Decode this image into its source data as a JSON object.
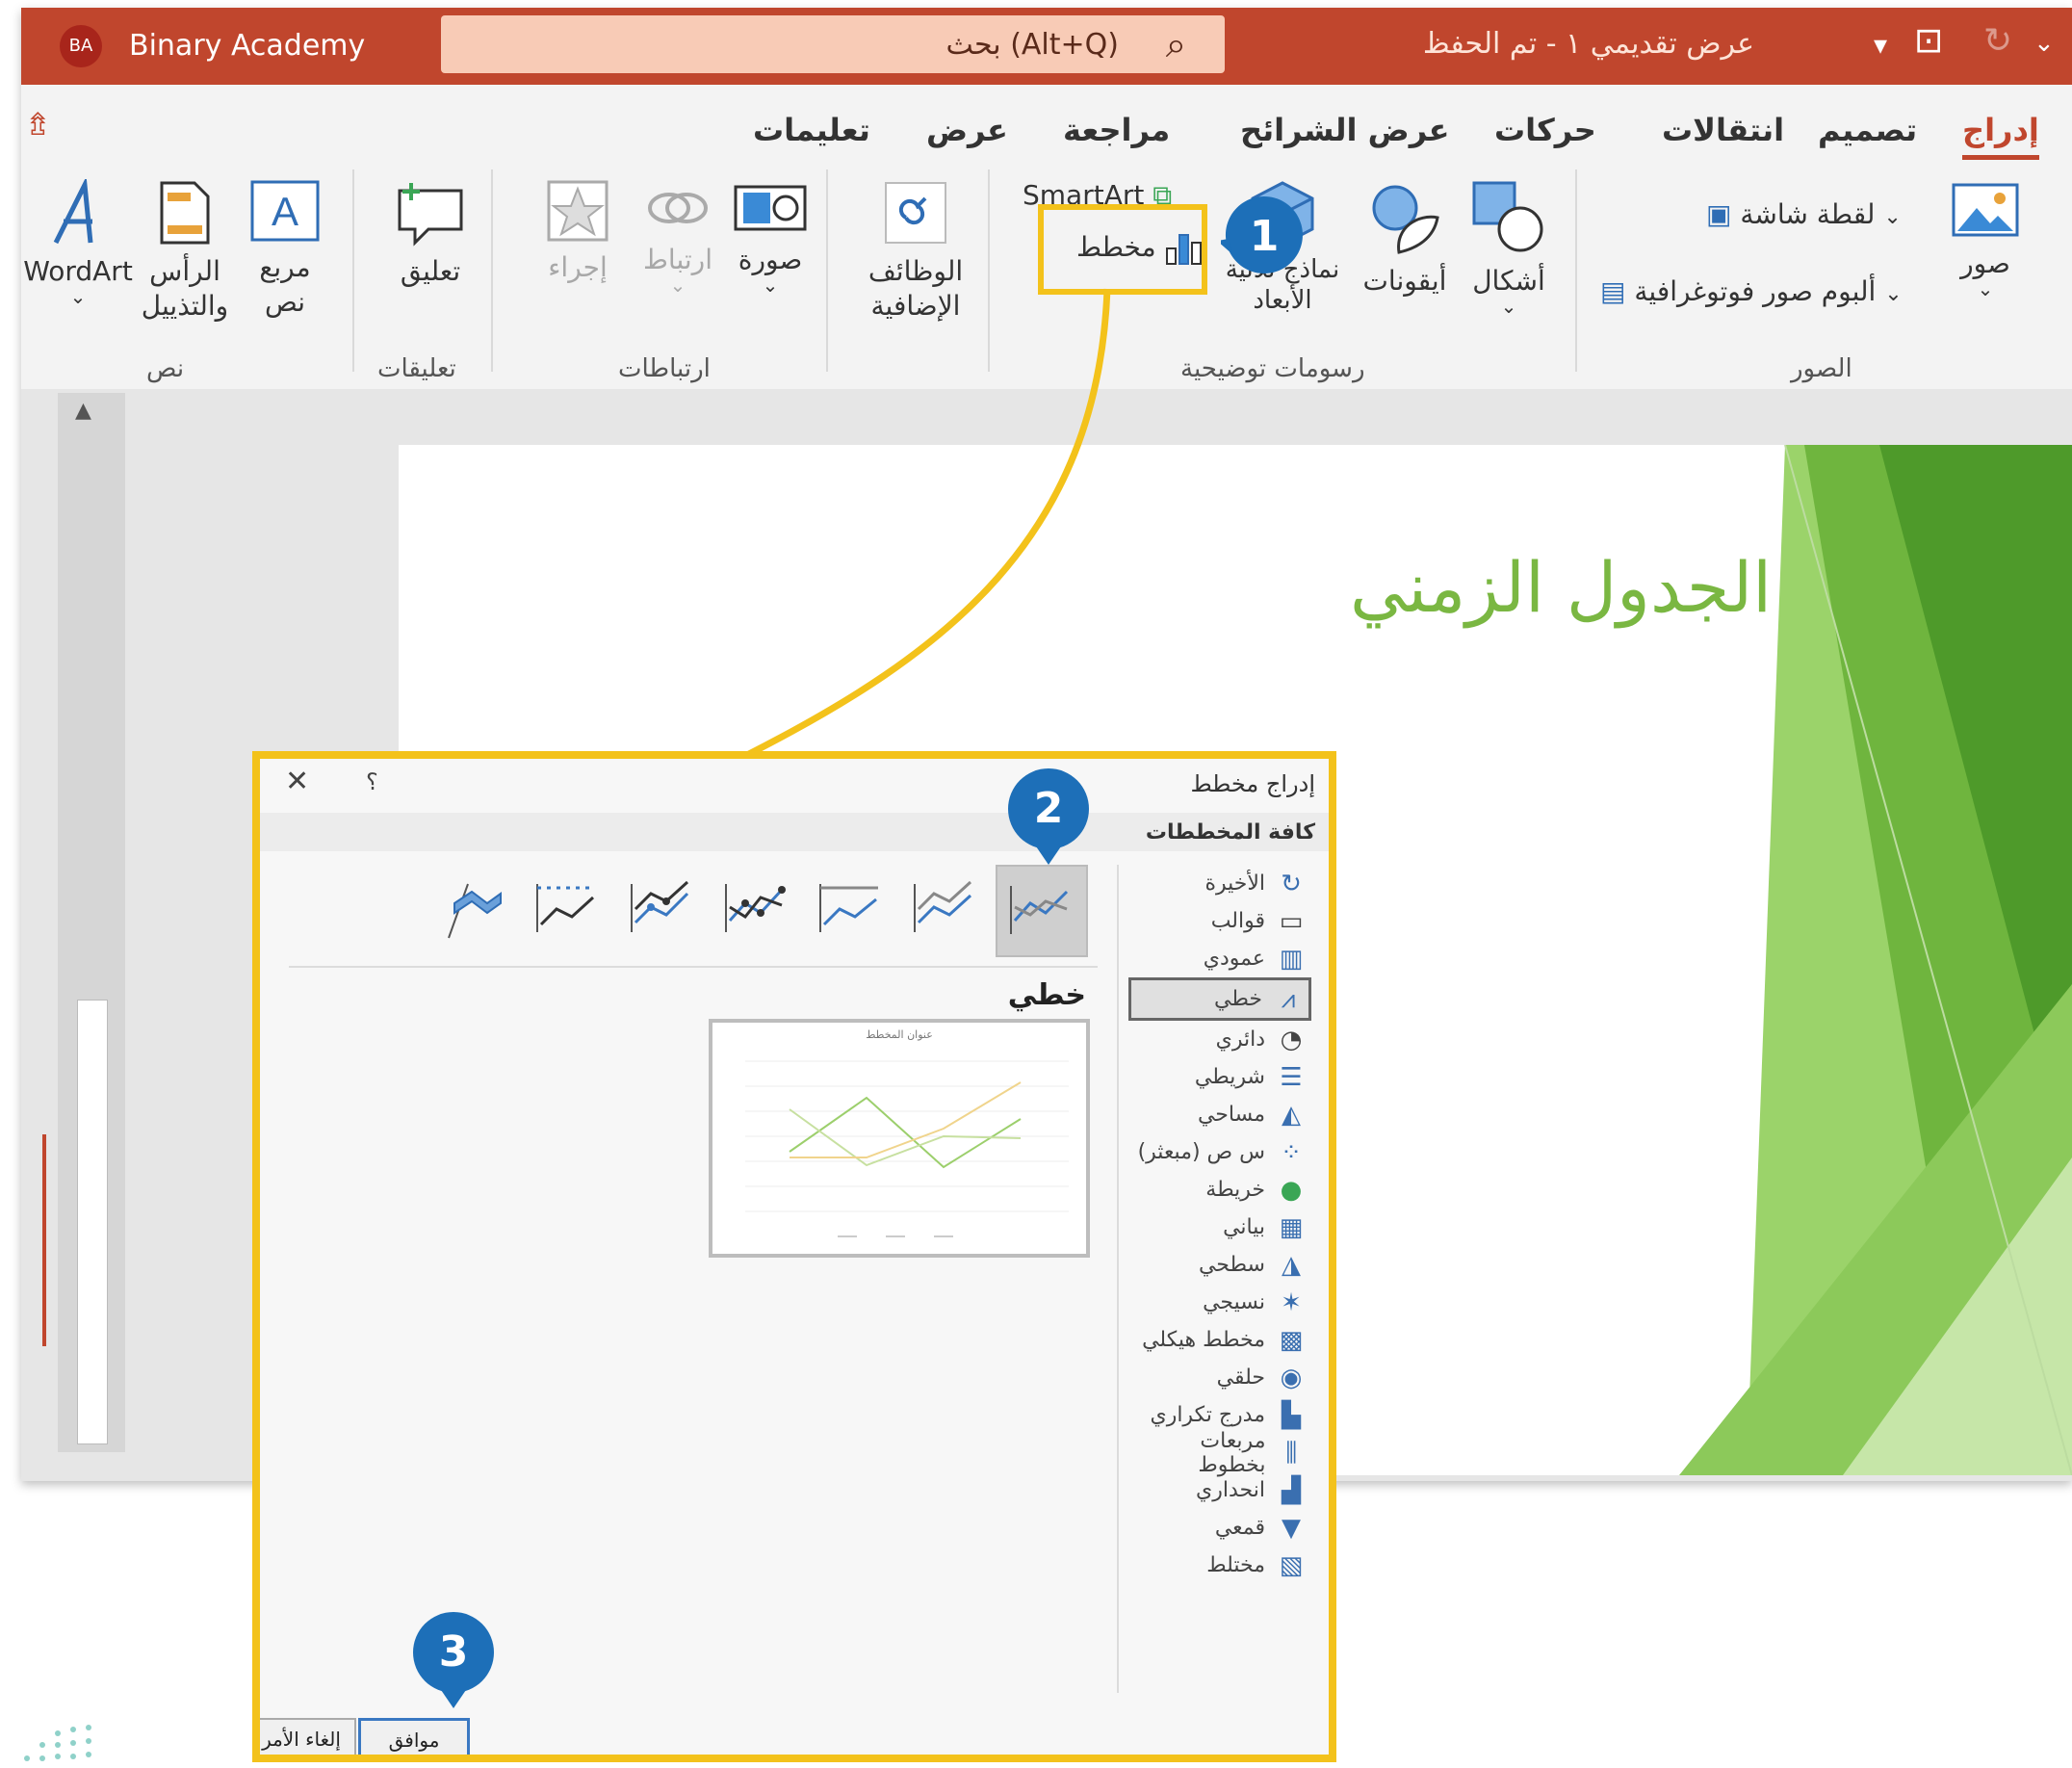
{
  "titlebar": {
    "avatar_initials": "BA",
    "user_name": "Binary Academy",
    "search_placeholder": "بحث (Alt+Q)",
    "document_title": "عرض تقديمي ١ - تم الحفظ"
  },
  "ribbon_tabs": [
    "إدراج",
    "تصميم",
    "انتقالات",
    "حركات",
    "عرض الشرائح",
    "مراجعة",
    "عرض",
    "تعليمات"
  ],
  "ribbon": {
    "images_group": {
      "label": "الصور",
      "pictures": "صور",
      "screenshot": "لقطة شاشة",
      "photo_album": "ألبوم صور فوتوغرافية"
    },
    "illustrations_group": {
      "label": "رسومات توضيحية",
      "shapes": "أشكال",
      "icons": "أيقونات",
      "models_3d": "نماذج ثلاثية الأبعاد",
      "smartart": "SmartArt",
      "chart": "مخطط"
    },
    "addins_group": {
      "addins": "الوظائف الإضافية"
    },
    "links_group": {
      "label": "ارتباطات",
      "picture": "صورة",
      "link": "ارتباط",
      "action": "إجراء"
    },
    "comments_group": {
      "label": "تعليقات",
      "comment": "تعليق"
    },
    "text_group": {
      "label": "نص",
      "textbox": "مربع نص",
      "header_footer": "الرأس والتذييل",
      "wordart": "WordArt"
    }
  },
  "slide": {
    "title": "الجدول الزمني"
  },
  "dialog": {
    "title": "إدراج مخطط",
    "help": "؟",
    "tab": "كافة المخططات",
    "selected_type": "خطي",
    "preview_title": "عنوان المخطط",
    "categories": [
      {
        "label": "الأخيرة",
        "icon": "recent-icon"
      },
      {
        "label": "قوالب",
        "icon": "templates-icon"
      },
      {
        "label": "عمودي",
        "icon": "column-chart-icon"
      },
      {
        "label": "خطي",
        "icon": "line-chart-icon"
      },
      {
        "label": "دائري",
        "icon": "pie-chart-icon"
      },
      {
        "label": "شريطي",
        "icon": "bar-chart-icon"
      },
      {
        "label": "مساحي",
        "icon": "area-chart-icon"
      },
      {
        "label": "س ص (مبعثر)",
        "icon": "scatter-chart-icon"
      },
      {
        "label": "خريطة",
        "icon": "map-chart-icon"
      },
      {
        "label": "بياني",
        "icon": "stock-chart-icon"
      },
      {
        "label": "سطحي",
        "icon": "surface-chart-icon"
      },
      {
        "label": "نسيجي",
        "icon": "radar-chart-icon"
      },
      {
        "label": "مخطط هيكلي",
        "icon": "treemap-chart-icon"
      },
      {
        "label": "حلقي",
        "icon": "sunburst-chart-icon"
      },
      {
        "label": "مدرج تكراري",
        "icon": "histogram-chart-icon"
      },
      {
        "label": "مربعات بخطوط",
        "icon": "box-whisker-icon"
      },
      {
        "label": "انحداري",
        "icon": "waterfall-chart-icon"
      },
      {
        "label": "قمعي",
        "icon": "funnel-chart-icon"
      },
      {
        "label": "مختلط",
        "icon": "combo-chart-icon"
      }
    ],
    "ok": "موافق",
    "cancel": "إلغاء الأمر"
  },
  "callouts": [
    "1",
    "2",
    "3"
  ],
  "colors": {
    "titlebar": "#c0462d",
    "highlight": "#f3c21b",
    "badge": "#1d6fb8",
    "slide_title": "#7ab742"
  }
}
